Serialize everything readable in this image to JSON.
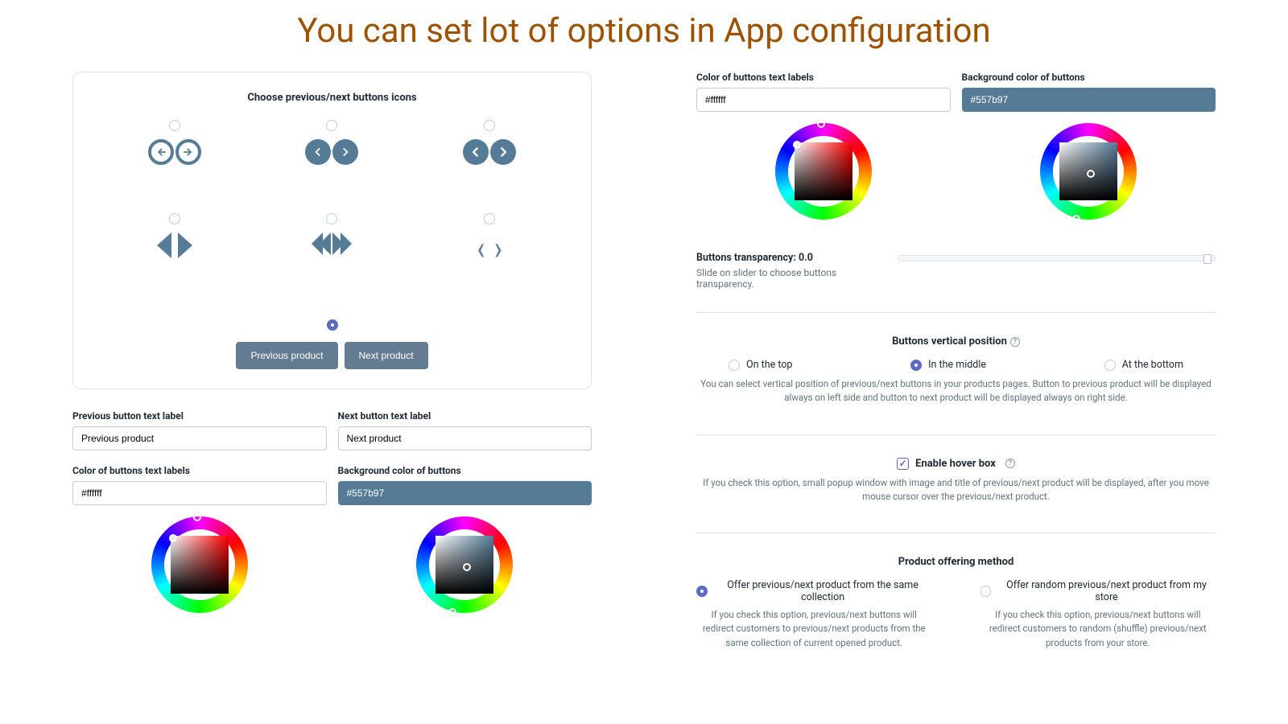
{
  "title": "You can set lot of options in App configuration",
  "card_title": "Choose previous/next buttons icons",
  "preview_prev": "Previous product",
  "preview_next": "Next product",
  "prev_label": "Previous button text label",
  "prev_value": "Previous product",
  "next_label": "Next button text label",
  "next_value": "Next product",
  "color_label": "Color of buttons text labels",
  "color_value": "#ffffff",
  "bg_label": "Background color of buttons",
  "bg_value": "#557b97",
  "trans_label": "Buttons transparency: 0.0",
  "trans_desc": "Slide on slider to choose buttons transparency.",
  "pos_title": "Buttons vertical position",
  "pos_top": "On the top",
  "pos_mid": "In the middle",
  "pos_bot": "At the bottom",
  "pos_desc": "You can select vertical position of previous/next buttons in your products pages. Button to previous product will be displayed always on left side and button to next product will be displayed always on right side.",
  "hover_label": "Enable hover box",
  "hover_desc": "If you check this option, small popup window with image and title of previous/next product will be displayed, after you move mouse cursor over the previous/next product.",
  "offer_title": "Product offering method",
  "offer1": "Offer previous/next product from the same collection",
  "offer1_desc": "If you check this option, previous/next buttons will redirect customers to previous/next products from the same collection of current opened product.",
  "offer2": "Offer random previous/next product from my store",
  "offer2_desc": "If you check this option, previous/next buttons will redirect customers to random (shuffle) previous/next products from your store."
}
